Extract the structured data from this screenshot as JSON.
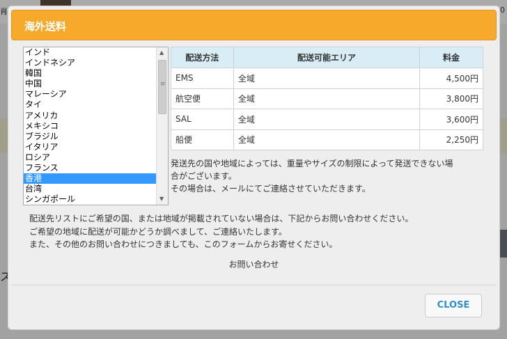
{
  "background": {
    "tag": "肖",
    "number": "00",
    "glyph": "ス"
  },
  "modal": {
    "title": "海外送料",
    "countries": [
      "インド",
      "インドネシア",
      "韓国",
      "中国",
      "マレーシア",
      "タイ",
      "アメリカ",
      "メキシコ",
      "ブラジル",
      "イタリア",
      "ロシア",
      "フランス",
      "香港",
      "台湾",
      "シンガポール"
    ],
    "selected_country": "香港",
    "table": {
      "headers": [
        "配送方法",
        "配送可能エリア",
        "料金"
      ],
      "rows": [
        {
          "method": "EMS",
          "area": "全域",
          "price": "4,500円"
        },
        {
          "method": "航空便",
          "area": "全域",
          "price": "3,800円"
        },
        {
          "method": "SAL",
          "area": "全域",
          "price": "3,600円"
        },
        {
          "method": "船便",
          "area": "全域",
          "price": "2,250円"
        }
      ]
    },
    "notice_lines": [
      "発送先の国や地域によっては、重量やサイズの制限によって発送できない場",
      "合がございます。",
      "その場合は、メールにてご連絡させていただきます。"
    ],
    "info_lines": [
      "配送先リストにご希望の国、または地域が掲載されていない場合は、下記からお問い合わせください。",
      "ご希望の地域に配送が可能かどうか調べまして、ご連絡いたします。",
      "また、その他のお問い合わせにつきましても、このフォームからお寄せください。"
    ],
    "contact_link": "お問い合わせ",
    "close_label": "CLOSE"
  },
  "colors": {
    "header": "#f7a92b",
    "table_header": "#d8edf6",
    "selected": "#3399ff",
    "close_text": "#2d8fc9"
  }
}
